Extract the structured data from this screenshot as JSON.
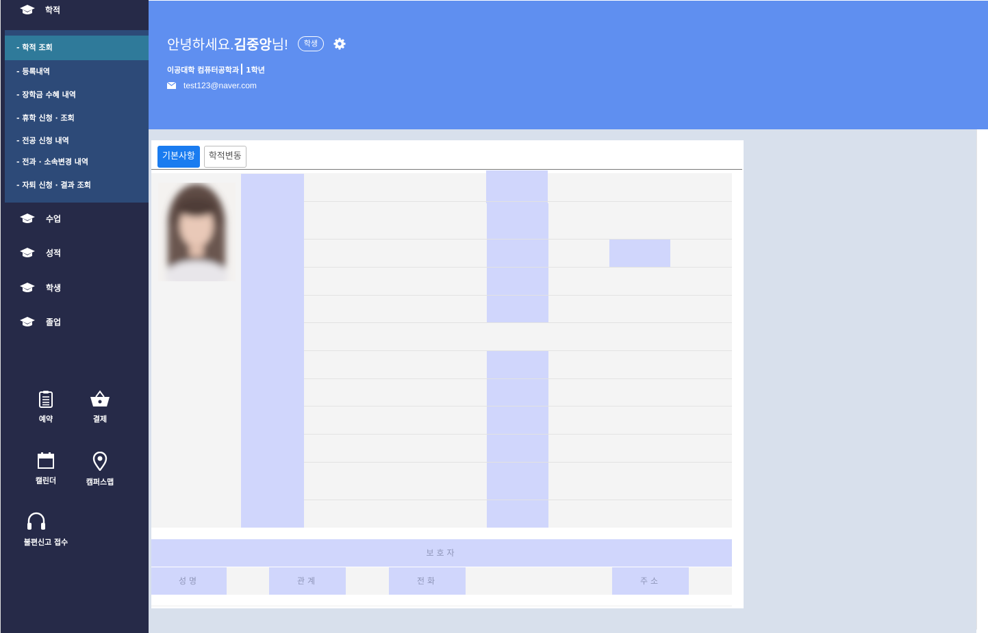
{
  "sidebar": {
    "top_label": "학적",
    "submenu": [
      {
        "label": "- 학적 조회",
        "active": true
      },
      {
        "label": "- 등록내역",
        "active": false
      },
      {
        "label": "- 장학금 수혜 내역",
        "active": false
      },
      {
        "label": "- 휴학 신청 · 조회",
        "active": false
      },
      {
        "label": "- 전공 신청 내역",
        "active": false
      },
      {
        "label": "- 전과 · 소속변경 내역",
        "active": false
      },
      {
        "label": "-  자퇴 신청 · 결과 조회",
        "active": false
      }
    ],
    "main": [
      "수업",
      "성적",
      "학생",
      "졸업"
    ],
    "quick": {
      "reserve": "예약",
      "payment": "결제",
      "calendar": "캘린더",
      "campus_map": "캠퍼스맵",
      "complaint": "불편신고 접수"
    }
  },
  "header": {
    "greeting_prefix": "안녕하세요. ",
    "name": "김중앙",
    "greeting_suffix": "님!",
    "role_badge": "학생",
    "department": "이공대학 컴퓨터공학과",
    "grade": "1학년",
    "email": "test123@naver.com"
  },
  "tabs": {
    "basic": "기본사항",
    "changes": "학적변동"
  },
  "guardian": {
    "title": "보호자",
    "name_label": "성명",
    "relation_label": "관계",
    "phone_label": "전화",
    "address_label": "주소"
  },
  "colors": {
    "sidebar_bg": "#262a48",
    "submenu_bg": "#2d4a78",
    "submenu_active": "#2f7a9a",
    "header_bg": "#5f8ff0",
    "label_cell": "#d0d6fc",
    "tab_active": "#1a7cf0"
  }
}
